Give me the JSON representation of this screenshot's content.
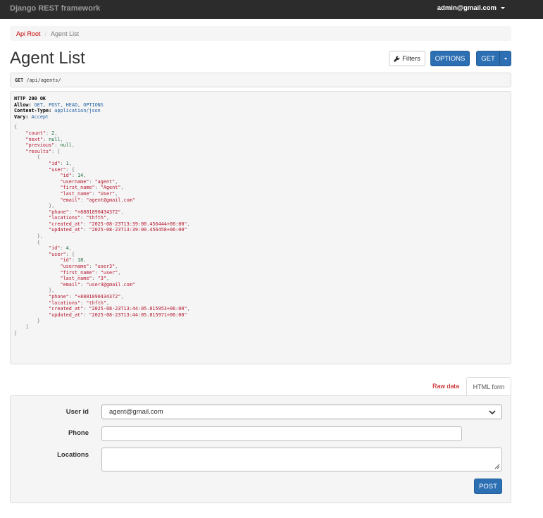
{
  "navbar": {
    "brand": "Django REST framework",
    "user": "admin@gmail.com"
  },
  "breadcrumb": {
    "root": "Api Root",
    "current": "Agent List"
  },
  "page": {
    "title": "Agent List"
  },
  "toolbar": {
    "filters_label": "Filters",
    "options_label": "OPTIONS",
    "get_label": "GET"
  },
  "request": {
    "method": "GET",
    "path": "/api/agents/"
  },
  "response": {
    "status_line": "HTTP 200 OK",
    "headers": [
      {
        "key": "Allow:",
        "value": "GET, POST, HEAD, OPTIONS"
      },
      {
        "key": "Content-Type:",
        "value": "application/json"
      },
      {
        "key": "Vary:",
        "value": "Accept"
      }
    ],
    "body": {
      "count": 2,
      "next": null,
      "previous": null,
      "results": [
        {
          "id": 1,
          "user": {
            "id": 14,
            "username": "agent",
            "first_name": "Agent",
            "last_name": "User",
            "email": "agent@gmail.com"
          },
          "phone": "+8801890434372",
          "locations": "thfth",
          "created_at": "2025-08-23T13:39:00.456444+06:00",
          "updated_at": "2025-08-23T13:39:00.456458+06:00"
        },
        {
          "id": 4,
          "user": {
            "id": 18,
            "username": "user3",
            "first_name": "user",
            "last_name": "3",
            "email": "user3@gmail.com"
          },
          "phone": "+8801890434372",
          "locations": "thfth",
          "created_at": "2025-08-23T13:44:05.015953+06:00",
          "updated_at": "2025-08-23T13:44:05.015971+06:00"
        }
      ]
    }
  },
  "tabs": {
    "raw": "Raw data",
    "html": "HTML form"
  },
  "form": {
    "user_label": "User id",
    "user_selected": "agent@gmail.com",
    "phone_label": "Phone",
    "phone_value": "",
    "locations_label": "Locations",
    "locations_value": "",
    "submit_label": "POST"
  },
  "colors": {
    "navbar_bg": "#2c2c2c",
    "primary": "#2c6fb3",
    "link_red": "#c20000"
  }
}
